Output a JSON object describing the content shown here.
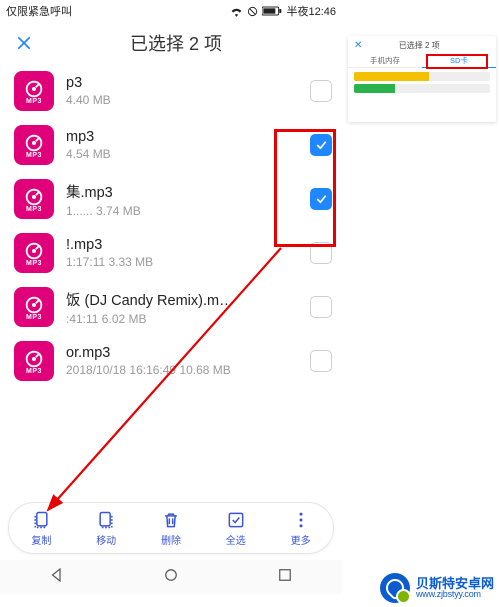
{
  "status": {
    "left": "仅限紧急呼叫",
    "time": "半夜12:46"
  },
  "header": {
    "title": "已选择 2 项"
  },
  "mp3Label": "MP3",
  "files": [
    {
      "name": "p3",
      "meta": "4.40 MB",
      "checked": false
    },
    {
      "name": "mp3",
      "meta": "4.54 MB",
      "checked": true
    },
    {
      "name": "集.mp3",
      "meta": "1...... 3.74 MB",
      "checked": true
    },
    {
      "name": "!.mp3",
      "meta": "1:17:11 3.33 MB",
      "checked": false
    },
    {
      "name": "饭 (DJ Candy Remix).m…",
      "meta": ":41:11 6.02 MB",
      "checked": false
    },
    {
      "name": "or.mp3",
      "meta": "2018/10/18 16:16:49 10.68 MB",
      "checked": false
    }
  ],
  "toolbar": [
    {
      "id": "copy",
      "label": "复制"
    },
    {
      "id": "move",
      "label": "移动"
    },
    {
      "id": "delete",
      "label": "删除"
    },
    {
      "id": "selall",
      "label": "全选"
    },
    {
      "id": "more",
      "label": "更多"
    }
  ],
  "callout": {
    "title": "已选择 2 项",
    "tabs": {
      "left": "手机内存",
      "right": "SD卡"
    }
  },
  "watermark": {
    "cn": "贝斯特安卓网",
    "url": "www.zjbstyy.com"
  }
}
